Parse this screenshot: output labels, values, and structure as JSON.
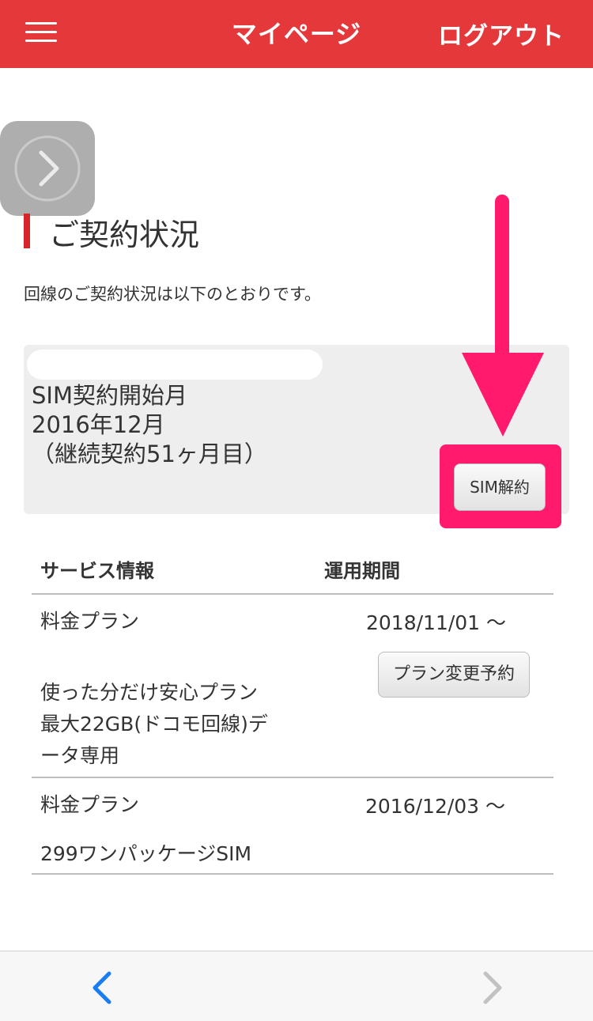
{
  "header": {
    "title": "マイページ",
    "logout_label": "ログアウト",
    "menu_icon": "hamburger-icon",
    "bg_color": "#e5383b"
  },
  "overlay": {
    "icon": "chevron-right-icon"
  },
  "section": {
    "title": "ご契約状況",
    "description": "回線のご契約状況は以下のとおりです。"
  },
  "contract": {
    "start_label": "SIM契約開始月",
    "start_month": "2016年12月",
    "duration": "（継続契約51ヶ月目）",
    "cancel_button": "SIM解約",
    "highlight_color": "#ff1a6e"
  },
  "services": {
    "headers": {
      "service": "サービス情報",
      "period": "運用期間"
    },
    "rows": [
      {
        "category": "料金プラン",
        "plan_lines": [
          "使った分だけ安心プラン",
          "最大22GB(ドコモ回線)デ",
          "ータ専用"
        ],
        "period": "2018/11/01 〜",
        "action_button": "プラン変更予約"
      },
      {
        "category": "料金プラン",
        "plan_lines": [
          "299ワンパッケージSIM"
        ],
        "period": "2016/12/03 〜"
      }
    ]
  },
  "toolbar": {
    "back_icon": "chevron-left-icon",
    "forward_icon": "chevron-right-icon"
  }
}
